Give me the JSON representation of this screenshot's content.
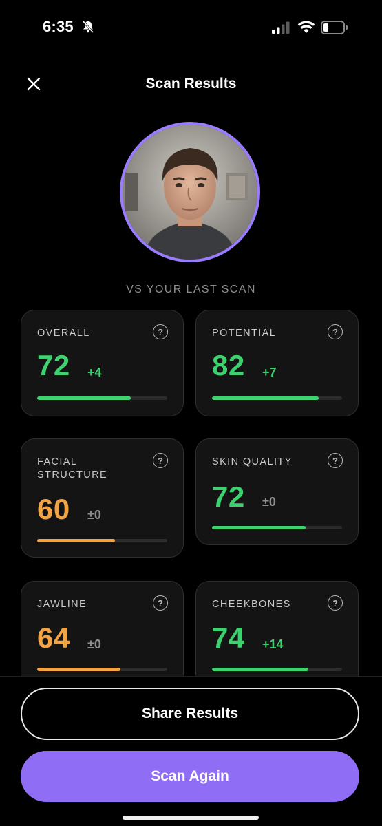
{
  "status_bar": {
    "time": "6:35"
  },
  "header": {
    "title": "Scan Results"
  },
  "compare_label": "VS YOUR LAST SCAN",
  "cards": [
    {
      "label": "OVERALL",
      "score": "72",
      "delta": "+4",
      "progress": 0.72,
      "color": "#3ed16f"
    },
    {
      "label": "POTENTIAL",
      "score": "82",
      "delta": "+7",
      "progress": 0.82,
      "color": "#3ed16f"
    },
    {
      "label": "FACIAL\nSTRUCTURE",
      "score": "60",
      "delta": "±0",
      "progress": 0.6,
      "color": "#f0a445"
    },
    {
      "label": "SKIN QUALITY",
      "score": "72",
      "delta": "±0",
      "progress": 0.72,
      "color": "#3ed16f"
    },
    {
      "label": "JAWLINE",
      "score": "64",
      "delta": "±0",
      "progress": 0.64,
      "color": "#f0a445"
    },
    {
      "label": "CHEEKBONES",
      "score": "74",
      "delta": "+14",
      "progress": 0.74,
      "color": "#3ed16f"
    }
  ],
  "buttons": {
    "share": "Share Results",
    "scan_again": "Scan Again"
  },
  "icons": [
    "bell-slash-icon",
    "signal-icon",
    "wifi-icon",
    "battery-icon",
    "close-icon",
    "help-icon"
  ],
  "colors": {
    "accent": "#8f6ef5",
    "ring": "#9b7bff",
    "good": "#3ed16f",
    "warn": "#f0a445",
    "neutral": "#8e8e8e"
  }
}
